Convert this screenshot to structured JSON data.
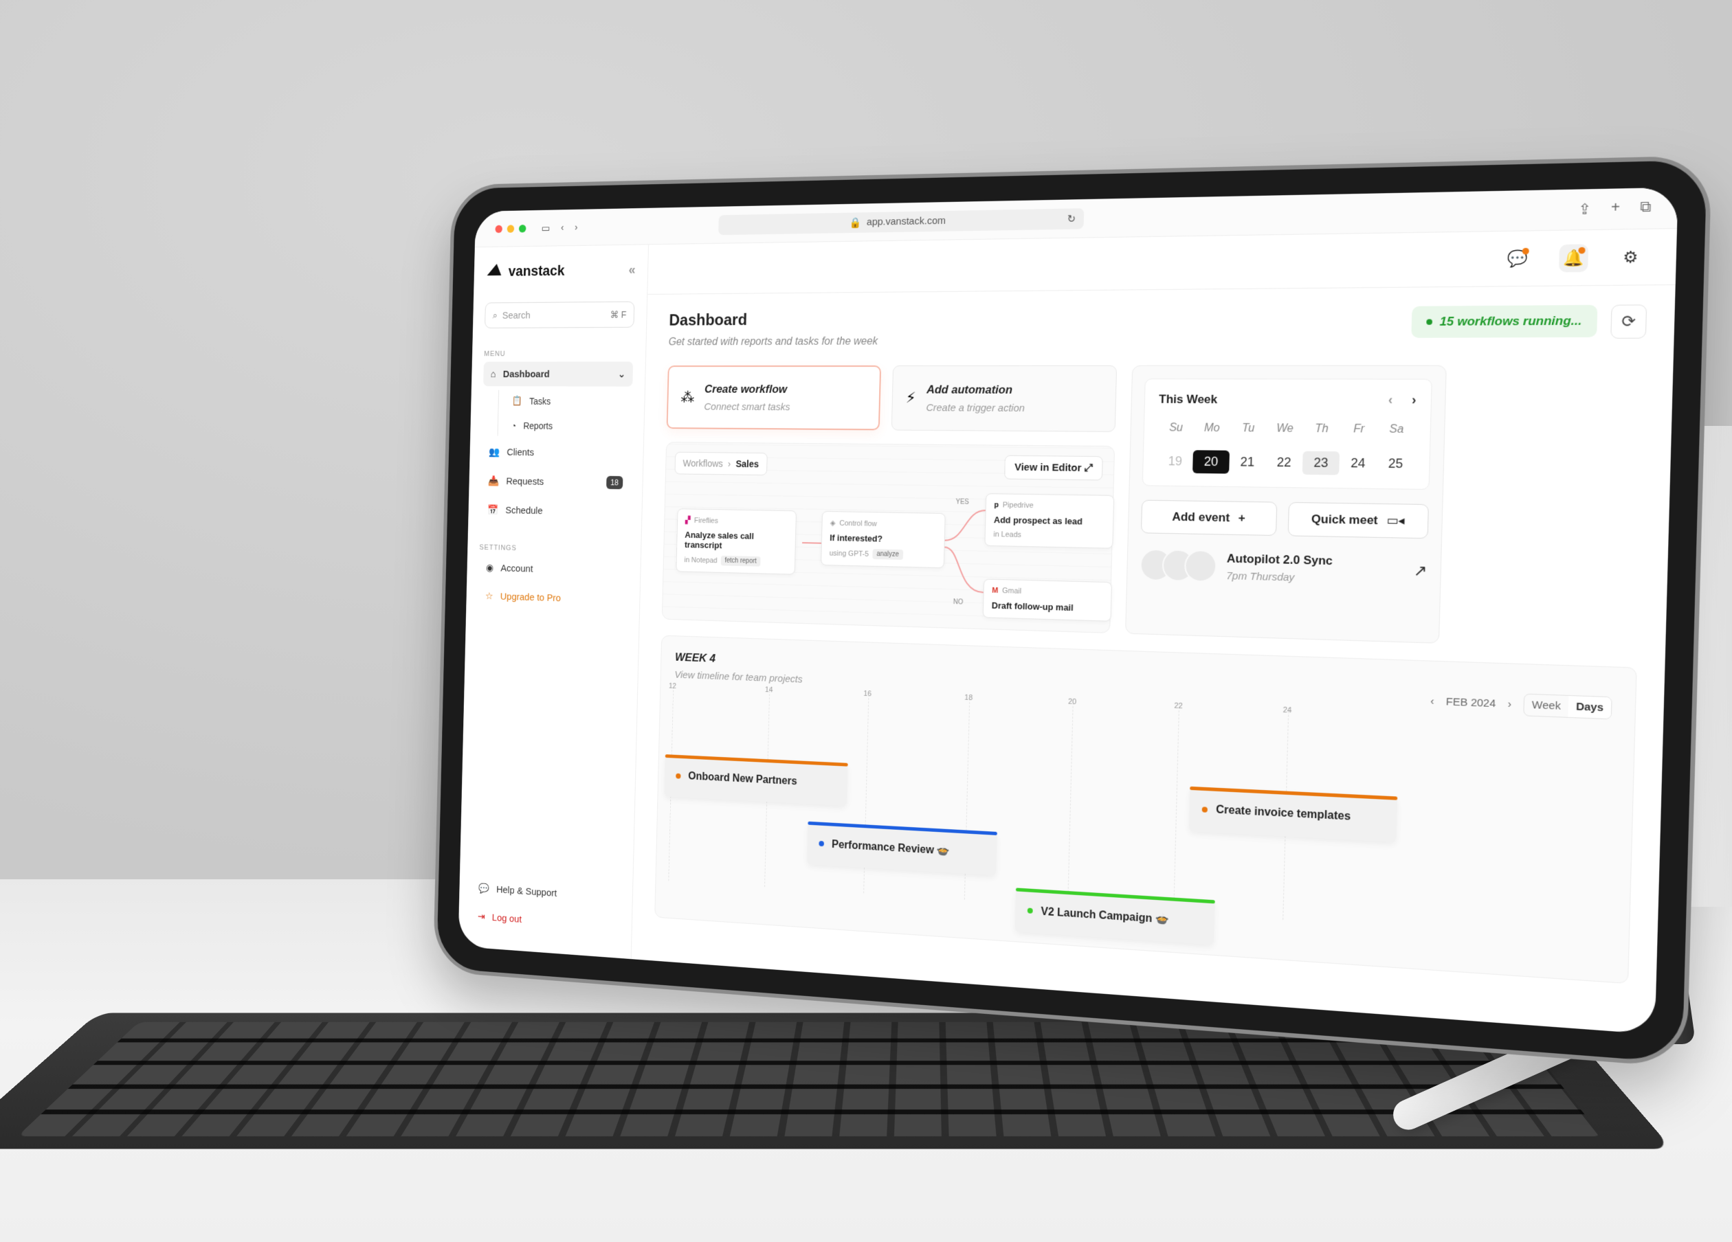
{
  "browser": {
    "url": "app.vanstack.com"
  },
  "brand": {
    "name": "vanstack"
  },
  "search": {
    "placeholder": "Search",
    "shortcut": "⌘ F"
  },
  "sidebar": {
    "menu_label": "MENU",
    "items": [
      {
        "label": "Dashboard"
      },
      {
        "label": "Tasks"
      },
      {
        "label": "Reports"
      },
      {
        "label": "Clients"
      },
      {
        "label": "Requests",
        "badge": "18"
      },
      {
        "label": "Schedule"
      }
    ],
    "settings_label": "SETTINGS",
    "settings_items": [
      {
        "label": "Account"
      },
      {
        "label": "Upgrade to Pro"
      }
    ],
    "help": "Help & Support",
    "logout": "Log out"
  },
  "header": {
    "title": "Dashboard",
    "subtitle": "Get started with reports and tasks for the week",
    "running": "15 workflows running..."
  },
  "cards": [
    {
      "title": "Create workflow",
      "subtitle": "Connect smart tasks"
    },
    {
      "title": "Add automation",
      "subtitle": "Create a trigger action"
    }
  ],
  "workflow": {
    "crumb_root": "Workflows",
    "crumb_current": "Sales",
    "view_editor": "View in Editor",
    "nodes": [
      {
        "source": "Fireflies",
        "title": "Analyze sales call transcript",
        "meta": "in Notepad",
        "tag": "fetch report"
      },
      {
        "source": "Control flow",
        "title": "If interested?",
        "meta": "using GPT-5",
        "tag": "analyze"
      },
      {
        "source": "Pipedrive",
        "title": "Add prospect as lead",
        "meta": "in Leads"
      },
      {
        "source": "Gmail",
        "title": "Draft follow-up mail"
      }
    ],
    "yes": "YES",
    "no": "NO"
  },
  "calendar": {
    "title": "This Week",
    "days": [
      "Su",
      "Mo",
      "Tu",
      "We",
      "Th",
      "Fr",
      "Sa"
    ],
    "dates": [
      "19",
      "20",
      "21",
      "22",
      "23",
      "24",
      "25"
    ],
    "selected": "20",
    "highlighted": "23",
    "add_event": "Add event",
    "quick_meet": "Quick meet",
    "meeting_title": "Autopilot 2.0 Sync",
    "meeting_time": "7pm Thursday"
  },
  "timeline": {
    "title": "WEEK 4",
    "subtitle": "View timeline for team projects",
    "month": "FEB 2024",
    "views": [
      "Week",
      "Days"
    ],
    "ticks": [
      "12",
      "14",
      "16",
      "18",
      "20",
      "22",
      "24"
    ],
    "tasks": [
      {
        "label": "Onboard New Partners",
        "color": "#e8770e"
      },
      {
        "label": "Performance Review 🍲",
        "color": "#1e5fe0"
      },
      {
        "label": "V2 Launch Campaign 🍲",
        "color": "#3ccf2a"
      },
      {
        "label": "Create invoice templates",
        "color": "#e8770e"
      }
    ]
  },
  "colors": {
    "accent": "#e8770e",
    "running_green": "#1f9a2b",
    "logout_red": "#d21f1f"
  }
}
